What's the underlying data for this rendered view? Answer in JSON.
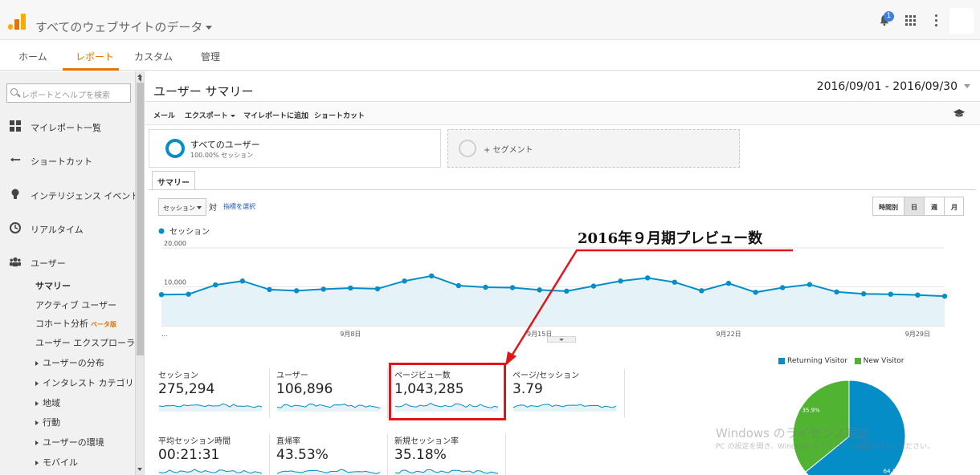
{
  "header": {
    "property_title": "すべてのウェブサイトのデータ",
    "notification_count": "1"
  },
  "nav_tabs": [
    {
      "label": "ホーム"
    },
    {
      "label": "レポート"
    },
    {
      "label": "カスタム"
    },
    {
      "label": "管理"
    }
  ],
  "sidebar": {
    "search_placeholder": "レポートとヘルプを検索",
    "items": [
      {
        "label": "マイレポート一覧",
        "icon": "grid-icon"
      },
      {
        "label": "ショートカット",
        "icon": "shortcut-icon"
      },
      {
        "label": "インテリジェンス イベント",
        "icon": "lightbulb-icon"
      },
      {
        "label": "リアルタイム",
        "icon": "clock-icon"
      },
      {
        "label": "ユーザー",
        "icon": "users-icon"
      }
    ],
    "subitems": [
      {
        "label": "サマリー"
      },
      {
        "label": "アクティブ ユーザー"
      },
      {
        "label": "コホート分析"
      },
      {
        "label": "ユーザー エクスプローラ"
      },
      {
        "label": "ユーザーの分布"
      },
      {
        "label": "インタレスト カテゴリ"
      },
      {
        "label": "地域"
      },
      {
        "label": "行動"
      },
      {
        "label": "ユーザーの環境"
      },
      {
        "label": "モバイル"
      }
    ],
    "beta_label": "ベータ版"
  },
  "main": {
    "title": "ユーザー サマリー",
    "date_range": "2016/09/01 - 2016/09/30",
    "toolbar": {
      "mail": "メール",
      "export": "エクスポート",
      "add_to_dashboard": "マイレポートに追加",
      "shortcut": "ショートカット"
    },
    "segments": {
      "all_users": "すべてのユーザー",
      "all_users_sub": "100.00% セッション",
      "add_segment": "+ セグメント"
    },
    "summary_tab": "サマリー",
    "metric_select": "セッション",
    "vs_label": "対",
    "pick_metric": "指標を選択",
    "granularity": [
      {
        "label": "時間別"
      },
      {
        "label": "日"
      },
      {
        "label": "週"
      },
      {
        "label": "月"
      }
    ],
    "annotation": "2016年９月期プレビュー数"
  },
  "chart_data": [
    {
      "type": "area",
      "series": [
        {
          "name": "セッション",
          "values": [
            8000,
            8100,
            10500,
            11500,
            9300,
            9000,
            9400,
            9700,
            9500,
            11500,
            12800,
            10300,
            9900,
            9800,
            9200,
            8900,
            10200,
            11500,
            12300,
            11200,
            9000,
            10900,
            8600,
            9800,
            10600,
            8700,
            8200,
            8100,
            7900,
            7600
          ]
        }
      ],
      "x": [
        "9/1",
        "9/2",
        "9/3",
        "9/4",
        "9/5",
        "9/6",
        "9/7",
        "9/8",
        "9/9",
        "9/10",
        "9/11",
        "9/12",
        "9/13",
        "9/14",
        "9/15",
        "9/16",
        "9/17",
        "9/18",
        "9/19",
        "9/20",
        "9/21",
        "9/22",
        "9/23",
        "9/24",
        "9/25",
        "9/26",
        "9/27",
        "9/28",
        "9/29",
        "9/30"
      ],
      "x_tick_labels": [
        "...",
        "9月8日",
        "9月15日",
        "9月22日",
        "9月29日"
      ],
      "y_tick_labels": [
        "20,000",
        "10,000"
      ],
      "ylim": [
        0,
        20000
      ],
      "color": "#058dc7"
    },
    {
      "type": "pie",
      "legend": [
        "Returning Visitor",
        "New Visitor"
      ],
      "values": [
        64.1,
        35.9
      ],
      "value_labels": [
        "64.1%",
        "35.9%"
      ],
      "colors": [
        "#058dc7",
        "#50b432"
      ]
    }
  ],
  "scorecards": [
    {
      "name": "セッション",
      "value": "275,294"
    },
    {
      "name": "ユーザー",
      "value": "106,896"
    },
    {
      "name": "ページビュー数",
      "value": "1,043,285"
    },
    {
      "name": "ページ/セッション",
      "value": "3.79"
    },
    {
      "name": "平均セッション時間",
      "value": "00:21:31"
    },
    {
      "name": "直帰率",
      "value": "43.53%"
    },
    {
      "name": "新規セッション率",
      "value": "35.18%"
    }
  ],
  "watermark": {
    "line1": "Windows のライセンス認証",
    "line2": "PC の設定を開き、Windows のライセンス認証を行ってください。"
  },
  "colors": {
    "accent": "#e37400",
    "series": "#058dc7",
    "highlight": "#e0161b"
  }
}
